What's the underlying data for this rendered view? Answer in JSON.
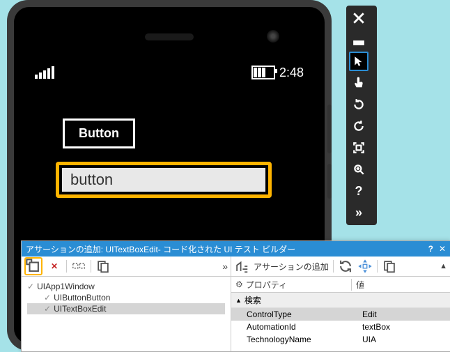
{
  "phone": {
    "clock": "2:48",
    "button_label": "Button",
    "textbox_value": "button"
  },
  "toolbar": {
    "items": [
      {
        "name": "close-icon"
      },
      {
        "name": "minimize-icon"
      },
      {
        "name": "pointer-icon",
        "selected": true
      },
      {
        "name": "touch-icon"
      },
      {
        "name": "rotate-left-icon"
      },
      {
        "name": "rotate-right-icon"
      },
      {
        "name": "fit-screen-icon"
      },
      {
        "name": "zoom-icon"
      },
      {
        "name": "help-icon"
      },
      {
        "name": "more-icon"
      }
    ]
  },
  "panel": {
    "title": "アサーションの追加: UITextBoxEdit- コード化された UI テスト ビルダー",
    "assertion_label": "アサーションの追加",
    "property_label": "プロパティ",
    "value_label": "値",
    "search_section": "検索",
    "tree": {
      "root": "UIApp1Window",
      "children": [
        "UIButtonButton",
        "UITextBoxEdit"
      ]
    },
    "properties": [
      {
        "name": "ControlType",
        "value": "Edit",
        "selected": true
      },
      {
        "name": "AutomationId",
        "value": "textBox"
      },
      {
        "name": "TechnologyName",
        "value": "UIA"
      }
    ]
  }
}
